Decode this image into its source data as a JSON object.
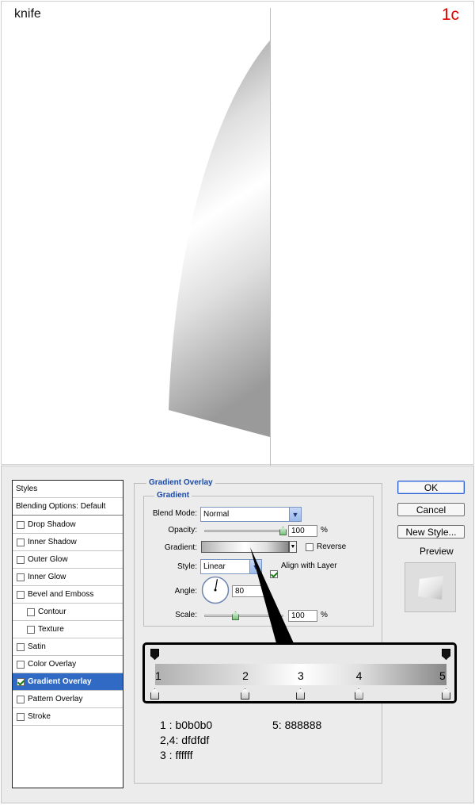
{
  "canvas": {
    "title": "knife",
    "step_label": "1c",
    "guide_color": "#5ce6e6"
  },
  "styles_panel": {
    "header": "Styles",
    "blending": "Blending Options: Default",
    "items": [
      {
        "label": "Drop Shadow",
        "checked": false,
        "indent": false
      },
      {
        "label": "Inner Shadow",
        "checked": false,
        "indent": false
      },
      {
        "label": "Outer Glow",
        "checked": false,
        "indent": false
      },
      {
        "label": "Inner Glow",
        "checked": false,
        "indent": false
      },
      {
        "label": "Bevel and Emboss",
        "checked": false,
        "indent": false
      },
      {
        "label": "Contour",
        "checked": false,
        "indent": true
      },
      {
        "label": "Texture",
        "checked": false,
        "indent": true
      },
      {
        "label": "Satin",
        "checked": false,
        "indent": false
      },
      {
        "label": "Color Overlay",
        "checked": false,
        "indent": false
      },
      {
        "label": "Gradient Overlay",
        "checked": true,
        "indent": false,
        "selected": true
      },
      {
        "label": "Pattern Overlay",
        "checked": false,
        "indent": false
      },
      {
        "label": "Stroke",
        "checked": false,
        "indent": false
      }
    ]
  },
  "gradient_overlay": {
    "section_title": "Gradient Overlay",
    "group_title": "Gradient",
    "blend_mode_label": "Blend Mode:",
    "blend_mode_value": "Normal",
    "opacity_label": "Opacity:",
    "opacity_value": "100",
    "opacity_unit": "%",
    "opacity_fraction": 1.0,
    "gradient_label": "Gradient:",
    "reverse_label": "Reverse",
    "reverse_checked": false,
    "style_label": "Style:",
    "style_value": "Linear",
    "align_label": "Align with Layer",
    "align_checked": true,
    "angle_label": "Angle:",
    "angle_value": "80",
    "angle_degrees": 80,
    "scale_label": "Scale:",
    "scale_value": "100",
    "scale_unit": "%",
    "scale_fraction": 0.4
  },
  "buttons": {
    "ok": "OK",
    "cancel": "Cancel",
    "new_style": "New Style...",
    "preview": "Preview",
    "preview_checked": true
  },
  "gradient_editor": {
    "stop_labels": [
      "1",
      "2",
      "3",
      "4",
      "5"
    ],
    "stop_positions": [
      0,
      0.31,
      0.5,
      0.7,
      1.0
    ],
    "stop_colors": [
      "#b0b0b0",
      "#dfdfdf",
      "#ffffff",
      "#dfdfdf",
      "#888888"
    ]
  },
  "notes": {
    "line1_left": "1   : b0b0b0",
    "line1_right": "5: 888888",
    "line2": "2,4: dfdfdf",
    "line3": "3   : ffffff"
  }
}
